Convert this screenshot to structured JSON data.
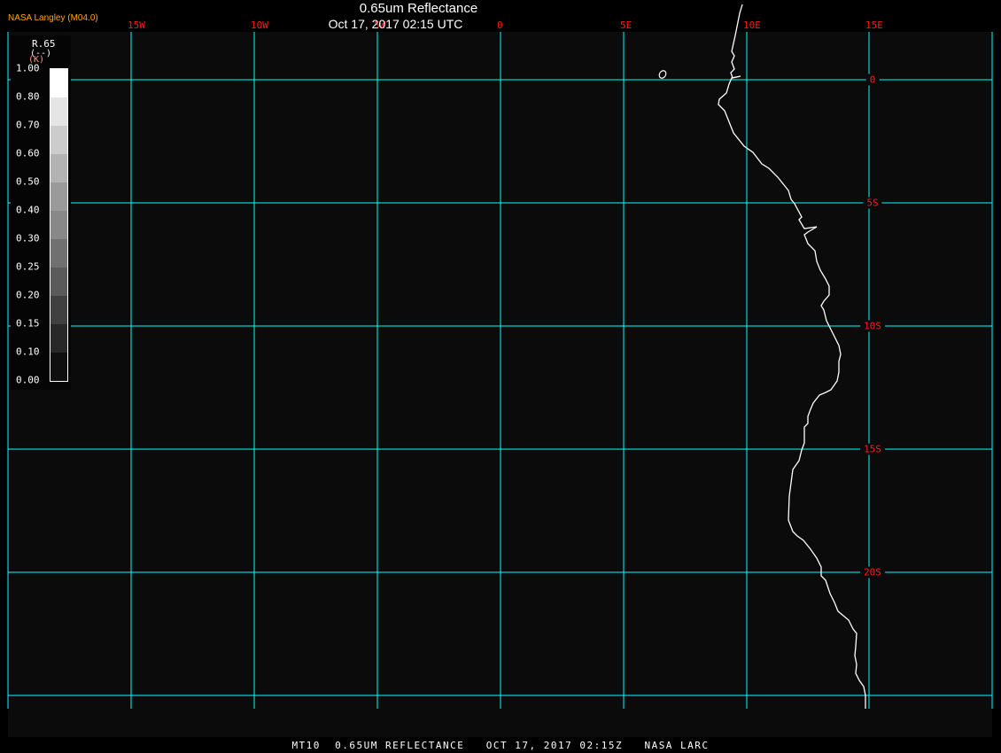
{
  "header": {
    "title": "0.65um Reflectance",
    "subtitle": "Oct 17, 2017 02:15 UTC",
    "producer": "NASA Langley (M04.0)"
  },
  "footer": {
    "text": "MT10  0.65UM REFLECTANCE   OCT 17, 2017 02:15Z   NASA LARC"
  },
  "map": {
    "background": "#0b0b0b",
    "grid_color": "#00ffff",
    "coastline_color": "#ffffff",
    "label_color": "#ff1a1a",
    "lon_labels": [
      "15W",
      "10W",
      "5W",
      "0",
      "5E",
      "10E",
      "15E"
    ],
    "lat_labels": [
      "0",
      "5S",
      "10S",
      "15S",
      "20S"
    ]
  },
  "colorbar": {
    "name": "R.65",
    "unit": "(--)",
    "unit2": "(K)",
    "labels": [
      "1.00",
      "0.80",
      "0.70",
      "0.60",
      "0.50",
      "0.40",
      "0.30",
      "0.25",
      "0.20",
      "0.15",
      "0.10",
      "0.00"
    ],
    "colors": [
      "#ffffff",
      "#e5e5e5",
      "#cccccc",
      "#b3b3b3",
      "#9a9a9a",
      "#888888",
      "#707070",
      "#5a5a5a",
      "#404040",
      "#282828",
      "#0f0f0f"
    ]
  }
}
